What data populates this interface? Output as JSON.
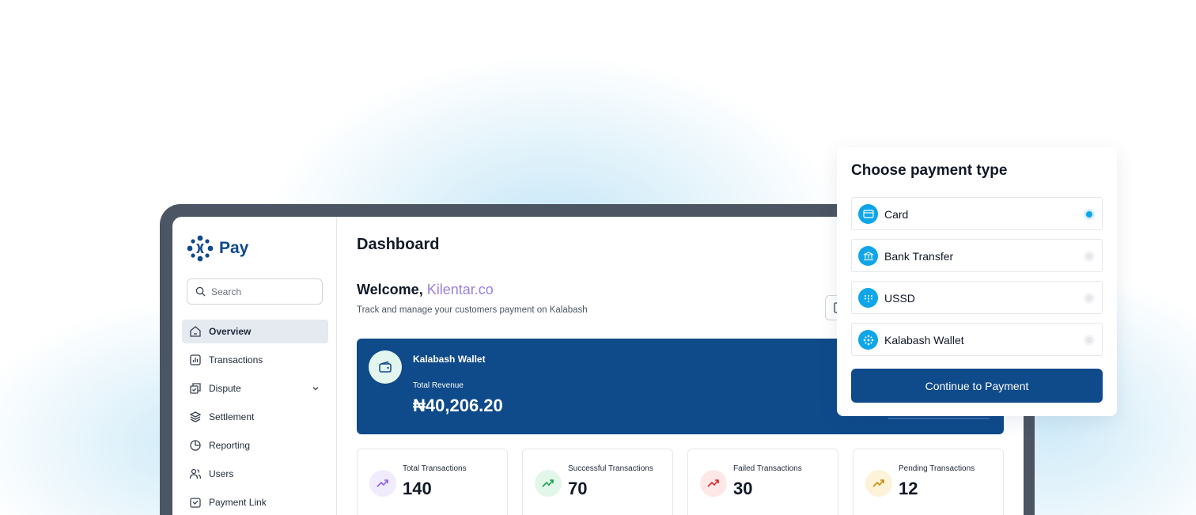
{
  "app": {
    "logo_text": "Pay",
    "brand_color": "#0f4a8a"
  },
  "sidebar": {
    "search_placeholder": "Search",
    "items": [
      {
        "label": "Overview",
        "icon": "home-icon",
        "active": true
      },
      {
        "label": "Transactions",
        "icon": "bar-chart-icon"
      },
      {
        "label": "Dispute",
        "icon": "dispute-icon",
        "has_submenu": true
      },
      {
        "label": "Settlement",
        "icon": "layers-icon"
      },
      {
        "label": "Reporting",
        "icon": "pie-chart-icon"
      },
      {
        "label": "Users",
        "icon": "users-icon"
      },
      {
        "label": "Payment Link",
        "icon": "payment-link-icon"
      }
    ]
  },
  "main": {
    "page_title": "Dashboard",
    "welcome_prefix": "Welcome,",
    "welcome_name": "Kilentar.co",
    "subtitle": "Track and manage your customers payment on Kalabash",
    "wallet": {
      "name": "Kalabash  Wallet",
      "revenue_label": "Total Revenue",
      "revenue_value": "₦40,206.20"
    },
    "stats": [
      {
        "label": "Total Transactions",
        "value": "140",
        "icon": "trend-up-icon",
        "color": "#8b5cf6",
        "bg": "#f1ecfd"
      },
      {
        "label": "Successful Transactions",
        "value": "70",
        "icon": "trend-up-icon",
        "color": "#16a34a",
        "bg": "#e3f6ea"
      },
      {
        "label": "Failed Transactions",
        "value": "30",
        "icon": "trend-up-icon",
        "color": "#dc2626",
        "bg": "#fde7e7"
      },
      {
        "label": "Pending Transactions",
        "value": "12",
        "icon": "trend-up-icon",
        "color": "#ca8a04",
        "bg": "#fdf3d8"
      }
    ]
  },
  "payment_modal": {
    "title": "Choose payment type",
    "options": [
      {
        "label": "Card",
        "icon": "card-icon",
        "selected": true
      },
      {
        "label": "Bank Transfer",
        "icon": "bank-icon",
        "selected": false
      },
      {
        "label": "USSD",
        "icon": "ussd-icon",
        "selected": false
      },
      {
        "label": "Kalabash Wallet",
        "icon": "wallet-icon",
        "selected": false
      }
    ],
    "continue_label": "Continue to Payment",
    "accent_color": "#0ea5e9"
  }
}
